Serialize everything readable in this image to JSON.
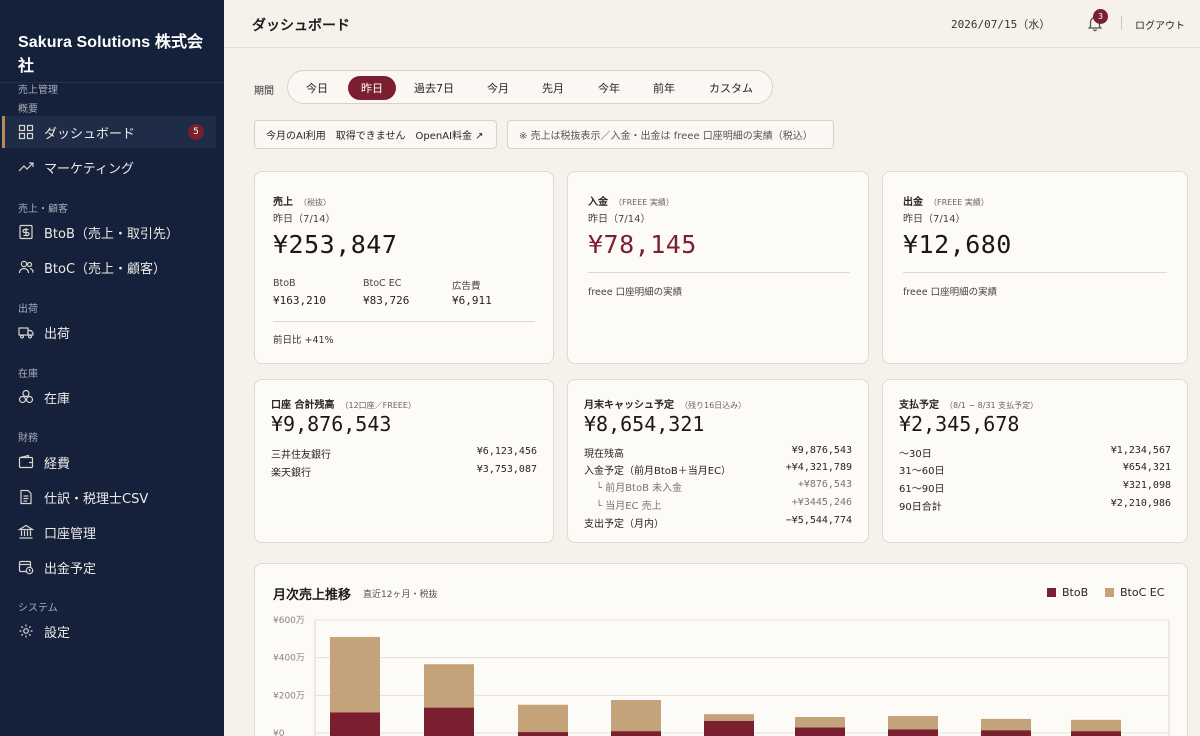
{
  "sidebar": {
    "brand": "Sakura Solutions 株式会社",
    "brand_sub": "売上管理",
    "sections": [
      "概要",
      "売上・顧客",
      "出荷",
      "在庫",
      "財務",
      "システム"
    ],
    "items": [
      {
        "label": "ダッシュボード",
        "badge": "5"
      },
      {
        "label": "マーケティング"
      },
      {
        "label": "BtoB（売上・取引先）"
      },
      {
        "label": "BtoC（売上・顧客）"
      },
      {
        "label": "出荷"
      },
      {
        "label": "在庫"
      },
      {
        "label": "経費"
      },
      {
        "label": "仕訳・税理士CSV"
      },
      {
        "label": "口座管理"
      },
      {
        "label": "出金予定"
      },
      {
        "label": "設定"
      }
    ]
  },
  "header": {
    "title": "ダッシュボード",
    "date": "2026/07/15（水）",
    "notifications": "3",
    "logout": "ログアウト"
  },
  "period": {
    "label": "期間",
    "options": [
      "今日",
      "昨日",
      "過去7日",
      "今月",
      "先月",
      "今年",
      "前年",
      "カスタム"
    ],
    "selected": "昨日"
  },
  "chips": {
    "ai": "今月のAI利用　取得できません　OpenAI料金 ↗",
    "note": "※ 売上は税抜表示／入金・出金は freee 口座明細の実績（税込）"
  },
  "sales_card": {
    "title": "売上",
    "title_sub": "（税抜）",
    "date": "昨日（7/14）",
    "value": "¥253,847",
    "breakdown": [
      {
        "label": "BtoB",
        "value": "¥163,210"
      },
      {
        "label": "BtoC EC",
        "value": "¥83,726"
      },
      {
        "label": "広告費",
        "value": "¥6,911"
      }
    ],
    "compare": "前日比 +41%"
  },
  "deposit_card": {
    "title": "入金",
    "title_sub": "（FREEE 実績）",
    "date": "昨日（7/14）",
    "value": "¥78,145",
    "note": "freee 口座明細の実績"
  },
  "withdraw_card": {
    "title": "出金",
    "title_sub": "（FREEE 実績）",
    "date": "昨日（7/14）",
    "value": "¥12,680",
    "note": "freee 口座明細の実績"
  },
  "balance_card": {
    "title": "口座 合計残高",
    "title_sub": "（12口座／FREEE）",
    "value": "¥9,876,543",
    "rows": [
      {
        "label": "三井住友銀行",
        "value": "¥6,123,456"
      },
      {
        "label": "楽天銀行",
        "value": "¥3,753,087"
      }
    ]
  },
  "cash_card": {
    "title": "月末キャッシュ予定",
    "title_sub": "（残り16日込み）",
    "value": "¥8,654,321",
    "rows": [
      {
        "label": "現在残高",
        "value": "¥9,876,543"
      },
      {
        "label": "入金予定（前月BtoB＋当月EC）",
        "value": "+¥4,321,789"
      },
      {
        "label": "└ 前月BtoB 未入金",
        "value": "+¥876,543"
      },
      {
        "label": "└ 当月EC 売上",
        "value": "+¥3445,246"
      },
      {
        "label": "支出予定（月内）",
        "value": "−¥5,544,774"
      }
    ]
  },
  "payment_card": {
    "title": "支払予定",
    "title_sub": "（8/1 − 8/31 支払予定）",
    "value": "¥2,345,678",
    "rows": [
      {
        "label": "〜30日",
        "value": "¥1,234,567"
      },
      {
        "label": "31〜60日",
        "value": "¥654,321"
      },
      {
        "label": "61〜90日",
        "value": "¥321,098"
      },
      {
        "label": "90日合計",
        "value": "¥2,210,986"
      }
    ]
  },
  "chart": {
    "title": "月次売上推移",
    "subtitle": "直近12ヶ月・税抜",
    "colors": {
      "btob": "#7a1f2f",
      "btoc": "#c4a27a"
    }
  },
  "chart_data": {
    "type": "bar",
    "stacked": true,
    "ylim": [
      0,
      600
    ],
    "yticks": [
      "¥0",
      "¥200万",
      "¥400万",
      "¥600万"
    ],
    "series": [
      {
        "name": "BtoB",
        "values": [
          110,
          135,
          5,
          10,
          65,
          30,
          20,
          15,
          10
        ]
      },
      {
        "name": "BtoC EC",
        "values": [
          400,
          230,
          145,
          165,
          35,
          55,
          70,
          60,
          60
        ]
      }
    ]
  }
}
